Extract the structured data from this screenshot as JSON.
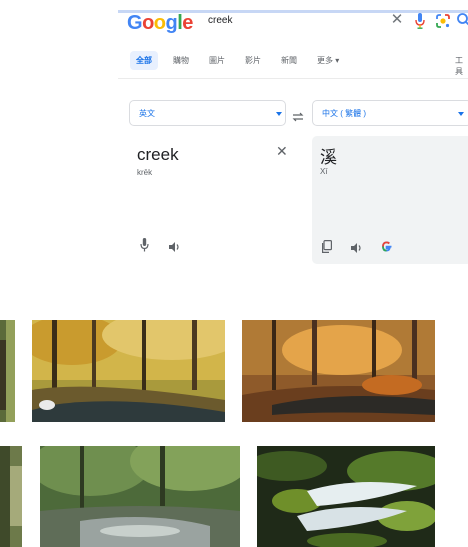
{
  "header": {
    "logo_text": "Google",
    "search_query": "creek"
  },
  "tabs": [
    {
      "label": "全部"
    },
    {
      "label": "購物"
    },
    {
      "label": "圖片"
    },
    {
      "label": "影片"
    },
    {
      "label": "新聞"
    },
    {
      "label": "更多 ▾"
    }
  ],
  "tools_label": "工具",
  "translate": {
    "source_lang": "英文",
    "target_lang": "中文 ( 繁體 )",
    "source_text": "creek",
    "source_pronunciation": "krēk",
    "target_text": "溪",
    "target_pronunciation": "Xī"
  },
  "icons": {
    "mic": "microphone-icon",
    "lens": "google-lens-icon",
    "search": "search-icon",
    "swap": "swap-languages-icon",
    "speaker": "speaker-icon",
    "copy": "copy-icon",
    "g": "google-g-icon"
  },
  "colors": {
    "accent": "#1a73e8",
    "panel_bg": "#f1f3f4",
    "border": "#dadce0"
  }
}
